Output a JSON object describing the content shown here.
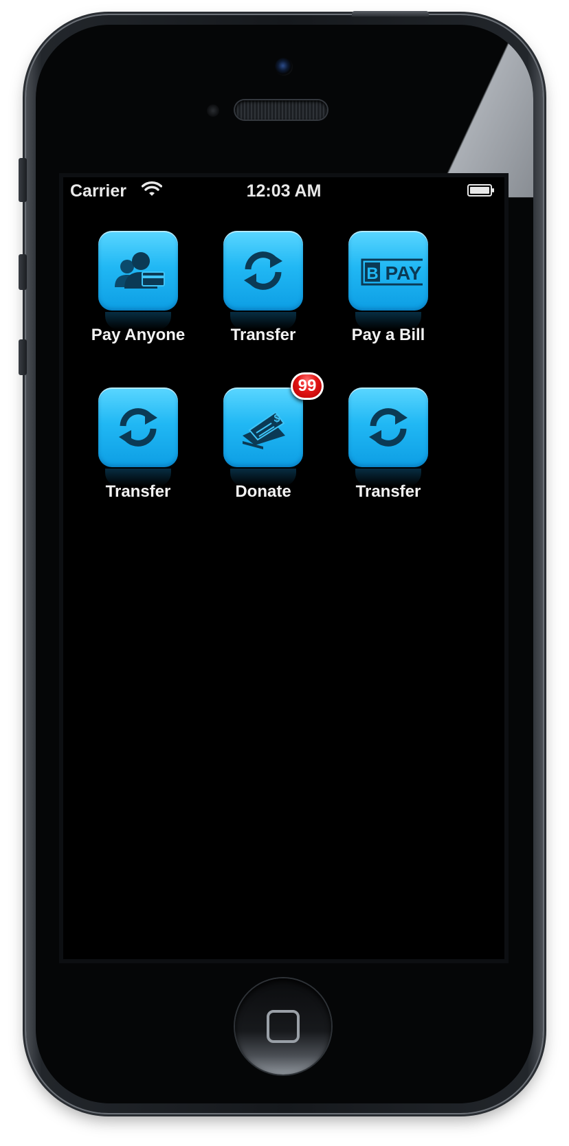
{
  "status_bar": {
    "carrier": "Carrier",
    "time": "12:03 AM",
    "wifi_icon": "wifi-icon",
    "battery_icon": "battery-icon"
  },
  "apps": [
    {
      "label": "Pay Anyone",
      "icon": "people-card-icon"
    },
    {
      "label": "Transfer",
      "icon": "refresh-arrows-icon"
    },
    {
      "label": "Pay a Bill",
      "icon": "bpay-logo-icon",
      "logo_text": "PAY"
    },
    {
      "label": "Transfer",
      "icon": "refresh-arrows-icon"
    },
    {
      "label": "Donate",
      "icon": "cheque-icon",
      "badge": "99"
    },
    {
      "label": "Transfer",
      "icon": "refresh-arrows-icon"
    }
  ],
  "colors": {
    "tile": "#21b8f4",
    "icon_glyph": "#0b3a55",
    "badge": "#e31616",
    "label": "#f2f2f2"
  }
}
